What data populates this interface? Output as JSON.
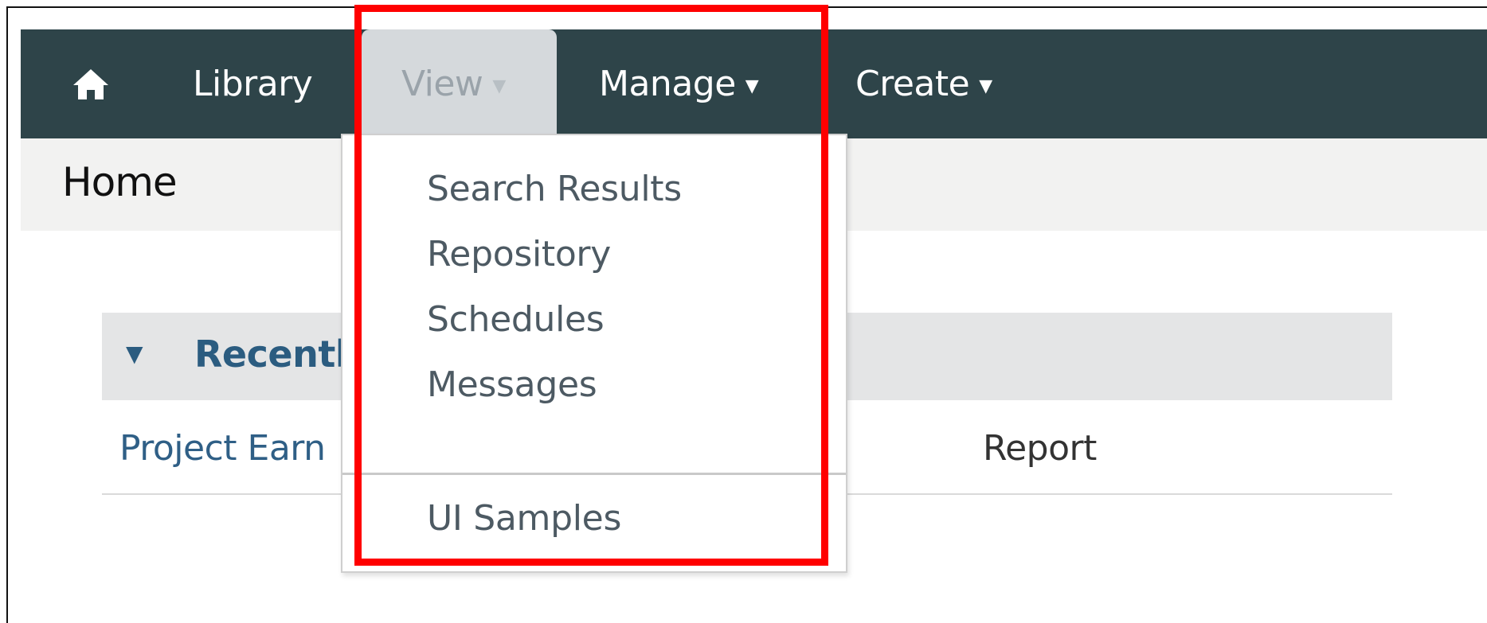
{
  "navbar": {
    "home_icon": "home-icon",
    "library": "Library",
    "view": "View",
    "manage": "Manage",
    "create": "Create",
    "caret_icon": "caret-down-icon"
  },
  "page": {
    "title": "Home"
  },
  "section": {
    "toggle_icon": "triangle-down-icon",
    "title": "Recently",
    "row": {
      "name": "Project Earn",
      "type": "Report"
    }
  },
  "view_menu": {
    "items": [
      "Search Results",
      "Repository",
      "Schedules",
      "Messages"
    ],
    "extra_item": "UI Samples"
  },
  "colors": {
    "navbar": "#2e4449",
    "active_tab": "#d5d9dc",
    "highlight": "#ff0000",
    "link": "#2f5f86"
  }
}
